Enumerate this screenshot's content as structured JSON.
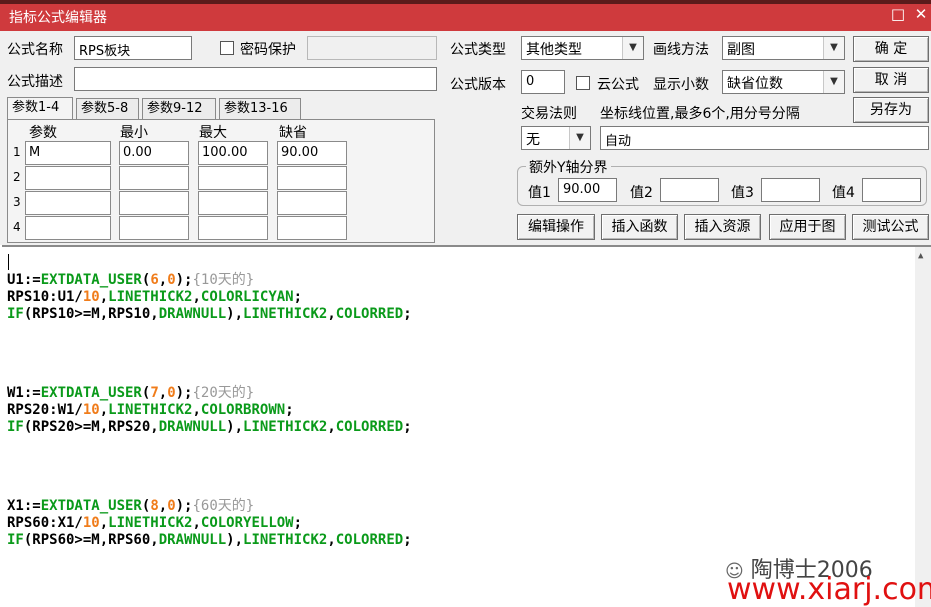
{
  "window": {
    "title": "指标公式编辑器",
    "min_glyph": "□",
    "close_glyph": "✕"
  },
  "form": {
    "name_label": "公式名称",
    "name_value": "RPS板块",
    "password_label": "密码保护",
    "desc_label": "公式描述",
    "desc_value": "",
    "type_label": "公式类型",
    "type_value": "其他类型",
    "draw_label": "画线方法",
    "draw_value": "副图",
    "version_label": "公式版本",
    "version_value": "0",
    "cloud_label": "云公式",
    "decimals_label": "显示小数",
    "decimals_value": "缺省位数",
    "trade_label": "交易法则",
    "trade_value": "无",
    "coord_label": "坐标线位置,最多6个,用分号分隔",
    "coord_value": "自动",
    "yaxis_title": "额外Y轴分界",
    "yaxis": [
      {
        "label": "值1",
        "value": "90.00"
      },
      {
        "label": "值2",
        "value": ""
      },
      {
        "label": "值3",
        "value": ""
      },
      {
        "label": "值4",
        "value": ""
      }
    ]
  },
  "buttons": {
    "ok": "确  定",
    "cancel": "取  消",
    "save_as": "另存为",
    "edit_ops": "编辑操作",
    "insert_func": "插入函数",
    "insert_res": "插入资源",
    "apply_chart": "应用于图",
    "test": "测试公式"
  },
  "tabs": [
    "参数1-4",
    "参数5-8",
    "参数9-12",
    "参数13-16"
  ],
  "params": {
    "headers": [
      "参数",
      "最小",
      "最大",
      "缺省"
    ],
    "rows": [
      {
        "n": "1",
        "name": "M",
        "min": "0.00",
        "max": "100.00",
        "def": "90.00"
      },
      {
        "n": "2",
        "name": "",
        "min": "",
        "max": "",
        "def": ""
      },
      {
        "n": "3",
        "name": "",
        "min": "",
        "max": "",
        "def": ""
      },
      {
        "n": "4",
        "name": "",
        "min": "",
        "max": "",
        "def": ""
      }
    ]
  },
  "code": {
    "lines": [
      {
        "t": 25,
        "segs": [
          [
            "p",
            "U1:="
          ],
          [
            "k",
            "EXTDATA_USER"
          ],
          [
            "p",
            "("
          ],
          [
            "n",
            "6"
          ],
          [
            "p",
            ","
          ],
          [
            "n",
            "0"
          ],
          [
            "p",
            ");"
          ],
          [
            "c",
            "{10天的}"
          ]
        ]
      },
      {
        "t": 42,
        "segs": [
          [
            "p",
            "RPS10:U1/"
          ],
          [
            "n",
            "10"
          ],
          [
            "p",
            ","
          ],
          [
            "k",
            "LINETHICK2"
          ],
          [
            "p",
            ","
          ],
          [
            "k",
            "COLORLICYAN"
          ],
          [
            "p",
            ";"
          ]
        ]
      },
      {
        "t": 59,
        "segs": [
          [
            "k",
            "IF"
          ],
          [
            "p",
            "(RPS10>=M,RPS10,"
          ],
          [
            "k",
            "DRAWNULL"
          ],
          [
            "p",
            "),"
          ],
          [
            "k",
            "LINETHICK2"
          ],
          [
            "p",
            ","
          ],
          [
            "k",
            "COLORRED"
          ],
          [
            "p",
            ";"
          ]
        ]
      },
      {
        "t": 138,
        "segs": [
          [
            "p",
            "W1:="
          ],
          [
            "k",
            "EXTDATA_USER"
          ],
          [
            "p",
            "("
          ],
          [
            "n",
            "7"
          ],
          [
            "p",
            ","
          ],
          [
            "n",
            "0"
          ],
          [
            "p",
            ");"
          ],
          [
            "c",
            "{20天的}"
          ]
        ]
      },
      {
        "t": 155,
        "segs": [
          [
            "p",
            "RPS20:W1/"
          ],
          [
            "n",
            "10"
          ],
          [
            "p",
            ","
          ],
          [
            "k",
            "LINETHICK2"
          ],
          [
            "p",
            ","
          ],
          [
            "k",
            "COLORBROWN"
          ],
          [
            "p",
            ";"
          ]
        ]
      },
      {
        "t": 172,
        "segs": [
          [
            "k",
            "IF"
          ],
          [
            "p",
            "(RPS20>=M,RPS20,"
          ],
          [
            "k",
            "DRAWNULL"
          ],
          [
            "p",
            "),"
          ],
          [
            "k",
            "LINETHICK2"
          ],
          [
            "p",
            ","
          ],
          [
            "k",
            "COLORRED"
          ],
          [
            "p",
            ";"
          ]
        ]
      },
      {
        "t": 251,
        "segs": [
          [
            "p",
            "X1:="
          ],
          [
            "k",
            "EXTDATA_USER"
          ],
          [
            "p",
            "("
          ],
          [
            "n",
            "8"
          ],
          [
            "p",
            ","
          ],
          [
            "n",
            "0"
          ],
          [
            "p",
            ");"
          ],
          [
            "c",
            "{60天的}"
          ]
        ]
      },
      {
        "t": 268,
        "segs": [
          [
            "p",
            "RPS60:X1/"
          ],
          [
            "n",
            "10"
          ],
          [
            "p",
            ","
          ],
          [
            "k",
            "LINETHICK2"
          ],
          [
            "p",
            ","
          ],
          [
            "k",
            "COLORYELLOW"
          ],
          [
            "p",
            ";"
          ]
        ]
      },
      {
        "t": 285,
        "segs": [
          [
            "k",
            "IF"
          ],
          [
            "p",
            "(RPS60>=M,RPS60,"
          ],
          [
            "k",
            "DRAWNULL"
          ],
          [
            "p",
            "),"
          ],
          [
            "k",
            "LINETHICK2"
          ],
          [
            "p",
            ","
          ],
          [
            "k",
            "COLORRED"
          ],
          [
            "p",
            ";"
          ]
        ]
      }
    ]
  },
  "watermark": {
    "author": "陶博士2006",
    "url": "www.xiarj.com"
  }
}
